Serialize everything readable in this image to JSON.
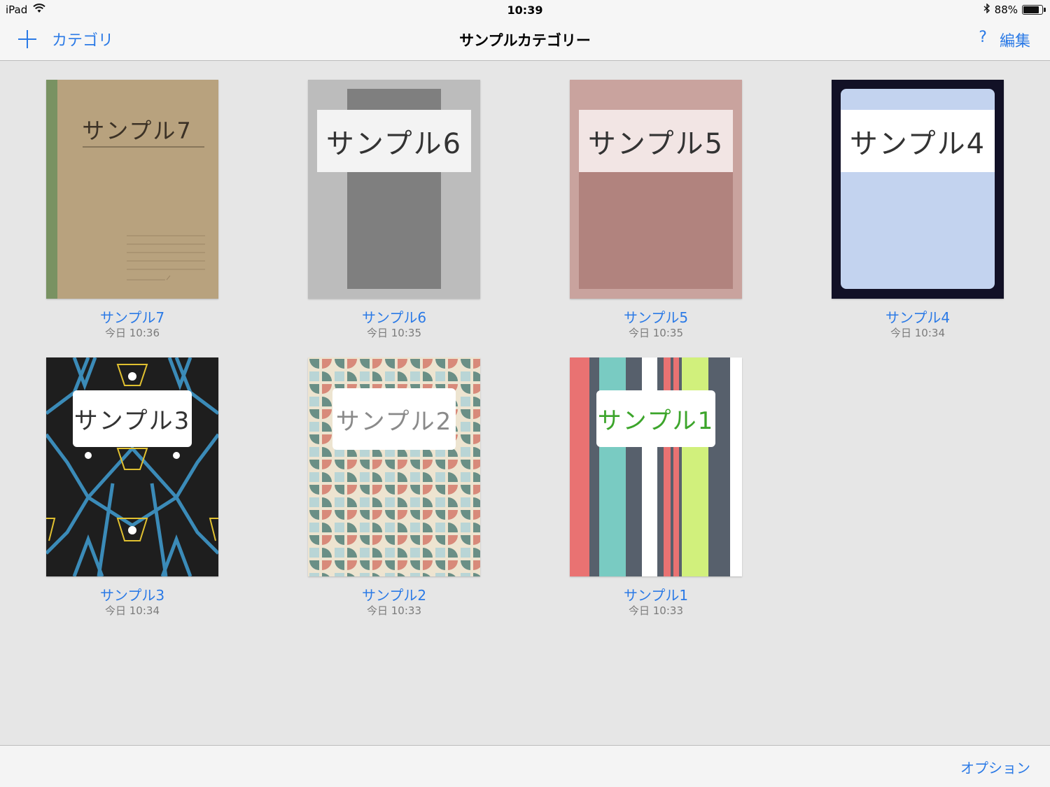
{
  "status": {
    "device": "iPad",
    "time": "10:39",
    "battery": "88%",
    "battery_level": 0.88
  },
  "nav": {
    "categories_label": "カテゴリ",
    "title": "サンプルカテゴリー",
    "help_label": "?",
    "edit_label": "編集"
  },
  "notebooks": [
    {
      "title": "サンプル7",
      "date": "今日 10:36",
      "cover_text": "サンプル7"
    },
    {
      "title": "サンプル6",
      "date": "今日 10:35",
      "cover_text": "サンプル6"
    },
    {
      "title": "サンプル5",
      "date": "今日 10:35",
      "cover_text": "サンプル5"
    },
    {
      "title": "サンプル4",
      "date": "今日 10:34",
      "cover_text": "サンプル4"
    },
    {
      "title": "サンプル3",
      "date": "今日 10:34",
      "cover_text": "サンプル3"
    },
    {
      "title": "サンプル2",
      "date": "今日 10:33",
      "cover_text": "サンプル2"
    },
    {
      "title": "サンプル1",
      "date": "今日 10:33",
      "cover_text": "サンプル1"
    }
  ],
  "toolbar": {
    "options_label": "オプション"
  },
  "colors": {
    "accent": "#2b7ae6",
    "background": "#e6e6e6"
  }
}
